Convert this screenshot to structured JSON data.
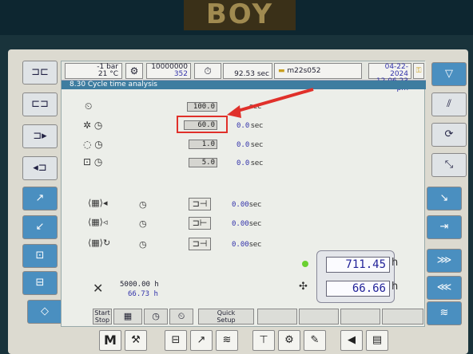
{
  "brand": "BOY",
  "header": {
    "pressure_value": "-1",
    "pressure_unit": "bar",
    "temp_value": "21",
    "temp_unit": "°C",
    "counter_total": "10000000",
    "counter_current": "352",
    "cycle_time": "92.53",
    "cycle_unit": "sec",
    "mold_name": "m22s052",
    "date": "04-22-2024",
    "time": "12.06.23 pm"
  },
  "title": "8.30 Cycle time analysis",
  "params": [
    {
      "value": "100.0",
      "actual": "",
      "unit": "sec"
    },
    {
      "value": "60.0",
      "actual": "0.0",
      "unit": "sec"
    },
    {
      "value": "1.0",
      "actual": "0.0",
      "unit": "sec"
    },
    {
      "value": "5.0",
      "actual": "0.0",
      "unit": "sec"
    }
  ],
  "ejector_rows": [
    {
      "actual": "0.00",
      "unit": "sec"
    },
    {
      "actual": "0.00",
      "unit": "sec"
    },
    {
      "actual": "0.00",
      "unit": "sec"
    }
  ],
  "hours": {
    "service_interval": "5000.00 h",
    "service_elapsed": "66.73 h",
    "operating_hours": "711.45",
    "motor_hours": "66.66",
    "unit": "h"
  },
  "tabs": [
    {
      "label_top": "Start",
      "label_bottom": "Stop"
    },
    {
      "label_top": "",
      "label_bottom": ""
    },
    {
      "label_top": "",
      "label_bottom": ""
    },
    {
      "label_top": "Quick",
      "label_bottom": "Setup"
    }
  ],
  "fkeys": {
    "m_label": "M"
  },
  "colors": {
    "title_bar": "#3e7da0",
    "highlight": "#e0302a",
    "status_green": "#6ad030"
  }
}
